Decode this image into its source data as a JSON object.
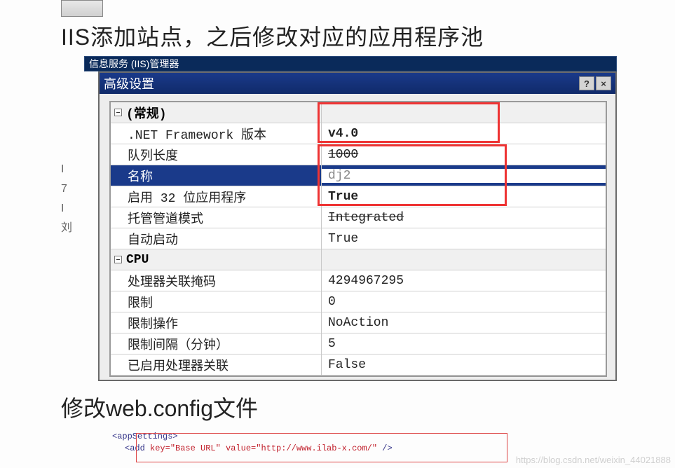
{
  "heading1": "IIS添加站点，之后修改对应的应用程序池",
  "fragTitle": "信息服务 (IIS)管理器",
  "dialogTitle": "高级设置",
  "helpBtn": "?",
  "closeBtn": "×",
  "categories": {
    "general": "(常规)",
    "cpu": "CPU"
  },
  "props": {
    "netfw": {
      "k": ".NET Framework 版本",
      "v": "v4.0"
    },
    "queue": {
      "k": "队列长度",
      "v": "1000"
    },
    "name": {
      "k": "名称",
      "v": "dj2"
    },
    "enable32": {
      "k": "启用 32 位应用程序",
      "v": "True"
    },
    "pipeline": {
      "k": "托管管道模式",
      "v": "Integrated"
    },
    "autostart": {
      "k": "自动启动",
      "v": "True"
    },
    "affmask": {
      "k": "处理器关联掩码",
      "v": "4294967295"
    },
    "limit": {
      "k": "限制",
      "v": "0"
    },
    "limitaction": {
      "k": "限制操作",
      "v": "NoAction"
    },
    "limitinterval": {
      "k": "限制间隔（分钟）",
      "v": "5"
    },
    "affenabled": {
      "k": "已启用处理器关联",
      "v": "False"
    }
  },
  "heading2": "修改web.config文件",
  "code": {
    "line1": "<appSettings>",
    "line2a": "<add ",
    "line2b": "key=\"Base URL\" value=\"http://www.ilab-x.com/\"",
    "line2c": " />"
  },
  "watermark": "https://blog.csdn.net/weixin_44021888"
}
